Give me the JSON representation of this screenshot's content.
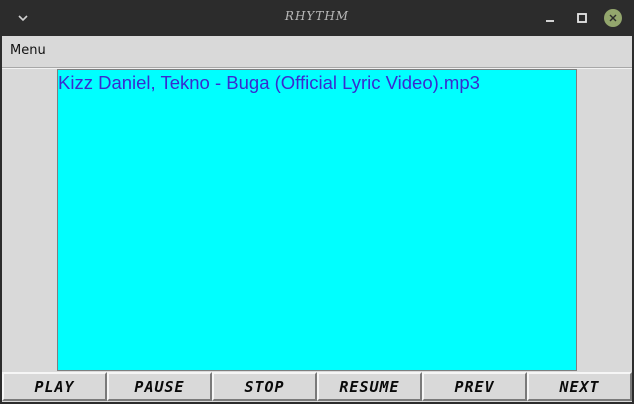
{
  "window": {
    "title": "RHYTHM",
    "buttons": {
      "menu": "chevron-down-icon",
      "minimize": "minimize-icon",
      "maximize": "maximize-icon",
      "close": "close-icon"
    }
  },
  "menubar": {
    "items": [
      {
        "label": "Menu"
      }
    ]
  },
  "playlist": {
    "background": "#00ffff",
    "text_color": "#3a2bd0",
    "items": [
      {
        "label": "Kizz Daniel, Tekno - Buga (Official Lyric Video).mp3"
      }
    ]
  },
  "controls": {
    "play": "PLAY",
    "pause": "PAUSE",
    "stop": "STOP",
    "resume": "RESUME",
    "prev": "PREV",
    "next": "NEXT"
  }
}
